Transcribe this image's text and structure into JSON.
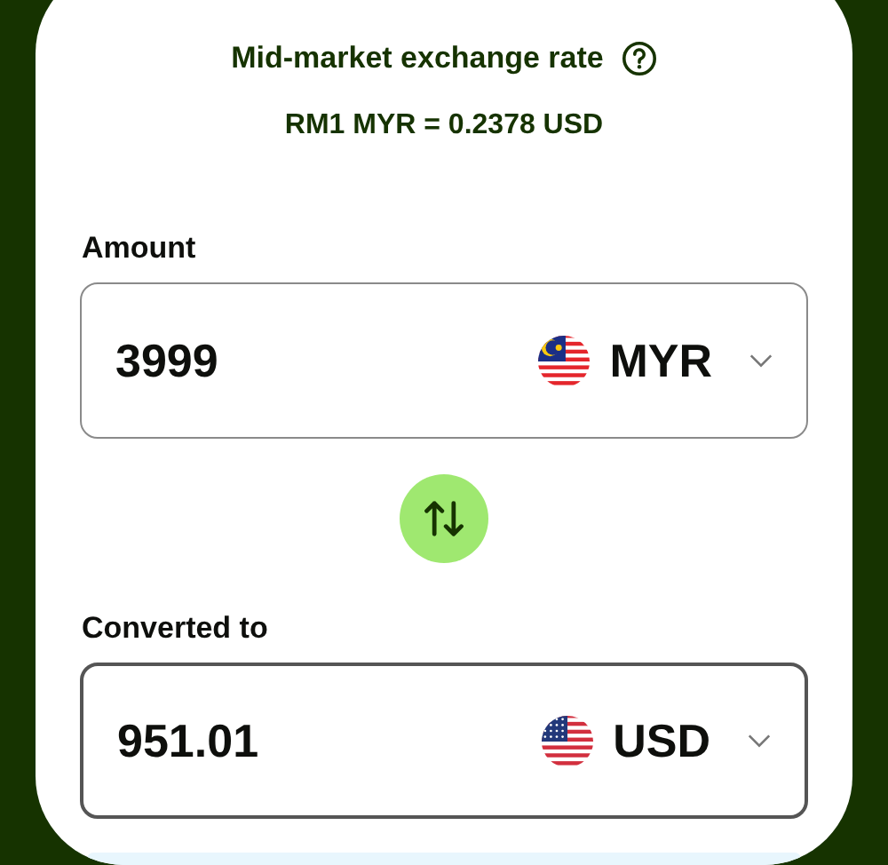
{
  "rate": {
    "title": "Mid-market exchange rate",
    "value": "RM1 MYR = 0.2378 USD"
  },
  "fields": [
    {
      "label": "Amount",
      "value": "3999",
      "currency": "MYR",
      "kind": "my",
      "focused": false
    },
    {
      "label": "Converted to",
      "value": "951.01",
      "currency": "USD",
      "kind": "us",
      "focused": true
    }
  ]
}
